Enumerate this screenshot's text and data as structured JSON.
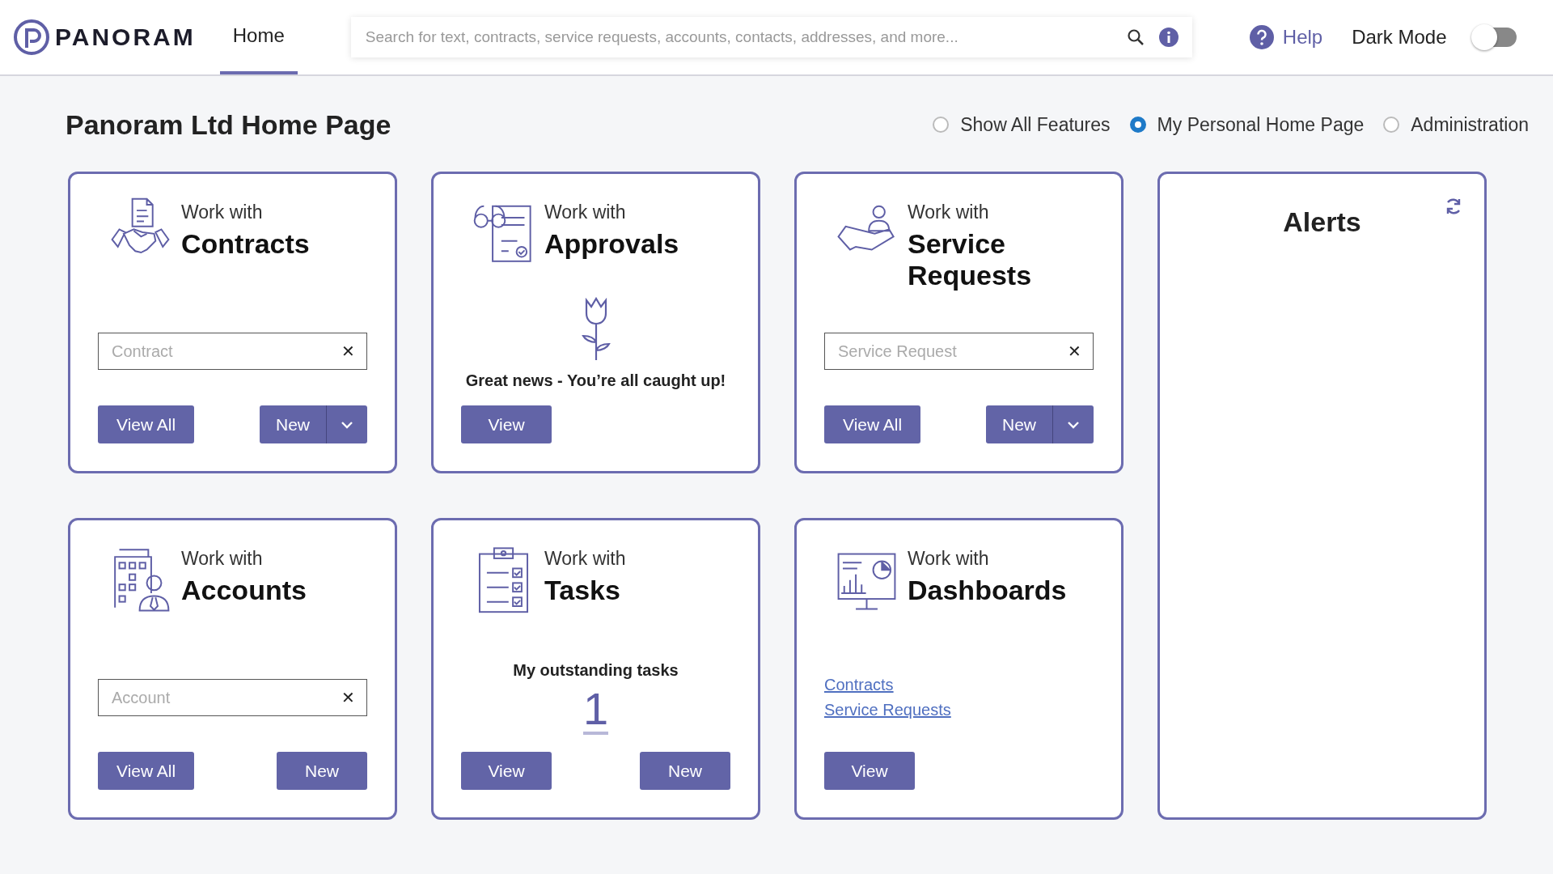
{
  "header": {
    "logo": "PANORAM",
    "nav": [
      {
        "label": "Home",
        "selected": true
      }
    ],
    "search": {
      "placeholder": "Search for text, contracts, service requests, accounts, contacts, addresses, and more..."
    },
    "help": "Help",
    "dark_mode": {
      "label": "Dark Mode",
      "on": false
    }
  },
  "page_title": "Panoram Ltd Home Page",
  "view_options": [
    {
      "label": "Show All Features",
      "selected": false
    },
    {
      "label": "My Personal Home Page",
      "selected": true
    },
    {
      "label": "Administration",
      "selected": false
    }
  ],
  "cards": [
    {
      "kind": "search",
      "prefix": "Work with",
      "title": "Contracts",
      "field": {
        "placeholder": "Contract",
        "clear": "✕"
      },
      "buttons": [
        {
          "label": "View All",
          "split": false
        },
        {
          "label": "New",
          "split": true
        }
      ]
    },
    {
      "kind": "approvals",
      "prefix": "Work with",
      "title": "Approvals",
      "message": "Great news - You’re all caught up!",
      "buttons": [
        {
          "label": "View",
          "split": false
        }
      ]
    },
    {
      "kind": "search",
      "prefix": "Work with",
      "title": "Service Requests",
      "field": {
        "placeholder": "Service Request",
        "clear": "✕"
      },
      "buttons": [
        {
          "label": "View All",
          "split": false
        },
        {
          "label": "New",
          "split": true
        }
      ]
    },
    {
      "kind": "search",
      "prefix": "Work with",
      "title": "Accounts",
      "field": {
        "placeholder": "Account",
        "clear": "✕"
      },
      "buttons": [
        {
          "label": "View All",
          "split": false
        },
        {
          "label": "New",
          "split": false
        }
      ]
    },
    {
      "kind": "tasks",
      "prefix": "Work with",
      "title": "Tasks",
      "message": "My outstanding tasks",
      "count": "1",
      "buttons": [
        {
          "label": "View",
          "split": false
        },
        {
          "label": "New",
          "split": false
        }
      ]
    },
    {
      "kind": "dashboards",
      "prefix": "Work with",
      "title": "Dashboards",
      "links": [
        "Contracts",
        "Service Requests"
      ],
      "buttons": [
        {
          "label": "View",
          "split": false
        }
      ]
    }
  ],
  "alerts": {
    "title": "Alerts"
  }
}
